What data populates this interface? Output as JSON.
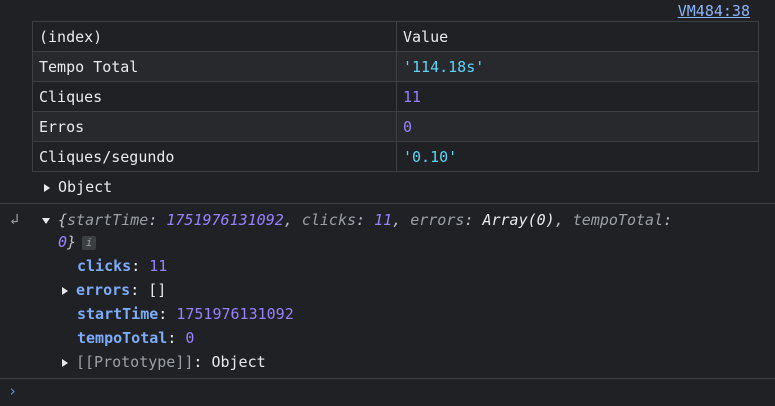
{
  "source_link": "VM484:38",
  "table": {
    "headers": [
      "(index)",
      "Value"
    ],
    "rows": [
      {
        "index": "Tempo Total",
        "value": "'114.18s'"
      },
      {
        "index": "Cliques",
        "value": "11"
      },
      {
        "index": "Erros",
        "value": "0"
      },
      {
        "index": "Cliques/segundo",
        "value": "'0.10'"
      }
    ]
  },
  "collapsed_object": "Object",
  "return_icon": "return-arrow-icon",
  "preview": {
    "open": "{",
    "k1": "startTime",
    "v1": "1751976131092",
    "k2": "clicks",
    "v2": "11",
    "k3": "errors",
    "v3": "Array(0)",
    "k4": "tempoTotal",
    "v4": "0",
    "close": "}",
    "info": "i"
  },
  "props": [
    {
      "key": "clicks",
      "value": "11"
    },
    {
      "key": "errors",
      "value": "[]"
    },
    {
      "key": "startTime",
      "value": "1751976131092"
    },
    {
      "key": "tempoTotal",
      "value": "0"
    }
  ],
  "prototype": {
    "key": "[[Prototype]]",
    "value": "Object"
  },
  "prompt_icon": "chevron-right-icon"
}
